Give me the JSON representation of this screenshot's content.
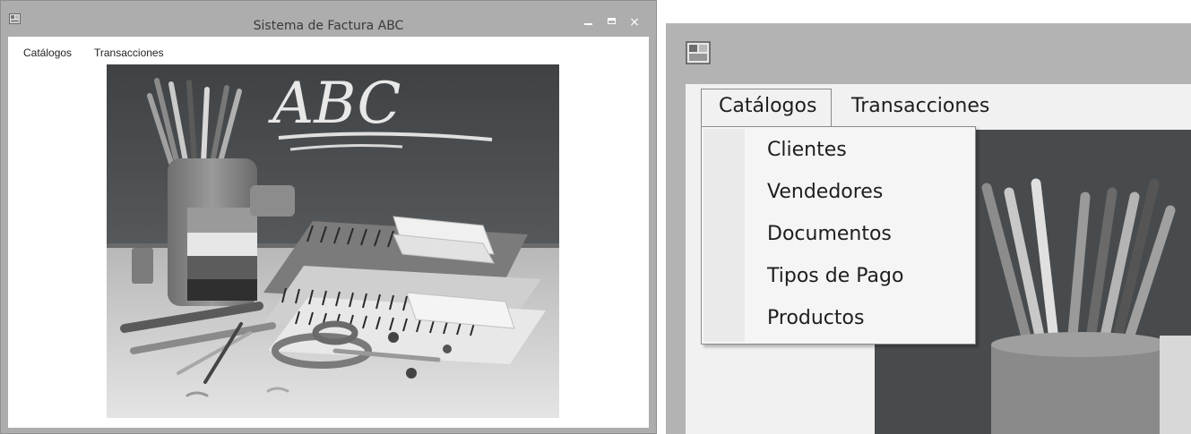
{
  "window": {
    "title": "Sistema de Factura ABC",
    "icon": "app-window-icon",
    "controls": {
      "minimize": "minimize-icon",
      "maximize": "maximize-icon",
      "close": "×"
    }
  },
  "menubar": {
    "items": [
      {
        "label": "Catálogos"
      },
      {
        "label": "Transacciones"
      }
    ]
  },
  "main_image": {
    "description_icon": "school-supplies-photo",
    "chalkboard_text": "ABC"
  },
  "zoom_panel": {
    "menubar": {
      "items": [
        {
          "label": "Catálogos",
          "state": "open"
        },
        {
          "label": "Transacciones"
        }
      ]
    },
    "dropdown": {
      "items": [
        {
          "label": "Clientes"
        },
        {
          "label": "Vendedores"
        },
        {
          "label": "Documentos"
        },
        {
          "label": "Tipos de Pago"
        },
        {
          "label": "Productos"
        }
      ]
    }
  },
  "colors": {
    "frame": "#adadad",
    "client_bg": "#ffffff",
    "menu_bg": "#f5f5f5",
    "chalkboard": "#4c5052"
  }
}
